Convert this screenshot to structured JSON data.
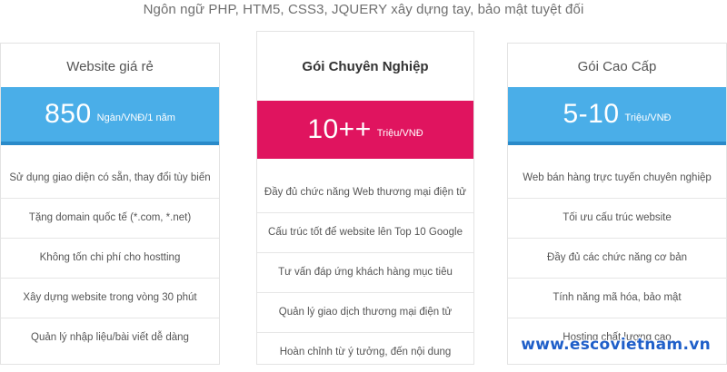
{
  "header": {
    "subtitle": "Ngôn ngữ PHP, HTM5, CSS3, JQUERY xây dựng tay, bảo mật tuyệt đối"
  },
  "colors": {
    "accent_blue": "#4aaee8",
    "accent_blue_border": "#2a8ac9",
    "accent_pink": "#e0145f",
    "watermark": "#1f5fc9"
  },
  "plans": [
    {
      "title": "Website giá rẻ",
      "price": "850",
      "unit": "Ngàn/VNĐ/1 năm",
      "features": [
        "Sử dụng giao diện có sẵn, thay đổi tùy biến",
        "Tặng domain quốc tế (*.com, *.net)",
        "Không tốn chi phí cho hostting",
        "Xây dựng website trong vòng 30 phút",
        "Quản lý nhập liệu/bài viết dễ dàng"
      ]
    },
    {
      "title": "Gói Chuyên Nghiệp",
      "price": "10++",
      "unit": "Triệu/VNĐ",
      "features": [
        "Đầy đủ chức năng Web thương mại điện tử",
        "Cấu trúc tốt để website lên Top 10 Google",
        "Tư vấn đáp ứng khách hàng mục tiêu",
        "Quản lý giao dịch thương mại điện tử",
        "Hoàn chỉnh từ ý tưởng, đến nội dung"
      ]
    },
    {
      "title": "Gói Cao Cấp",
      "price": "5-10",
      "unit": "Triệu/VNĐ",
      "features": [
        "Web bán hàng trực tuyến chuyên nghiệp",
        "Tối ưu cấu trúc website",
        "Đầy đủ các chức năng cơ bản",
        "Tính năng mã hóa, bảo mật",
        "Hosting chất lượng cao"
      ]
    }
  ],
  "watermark": "www.escovietnam.vn"
}
